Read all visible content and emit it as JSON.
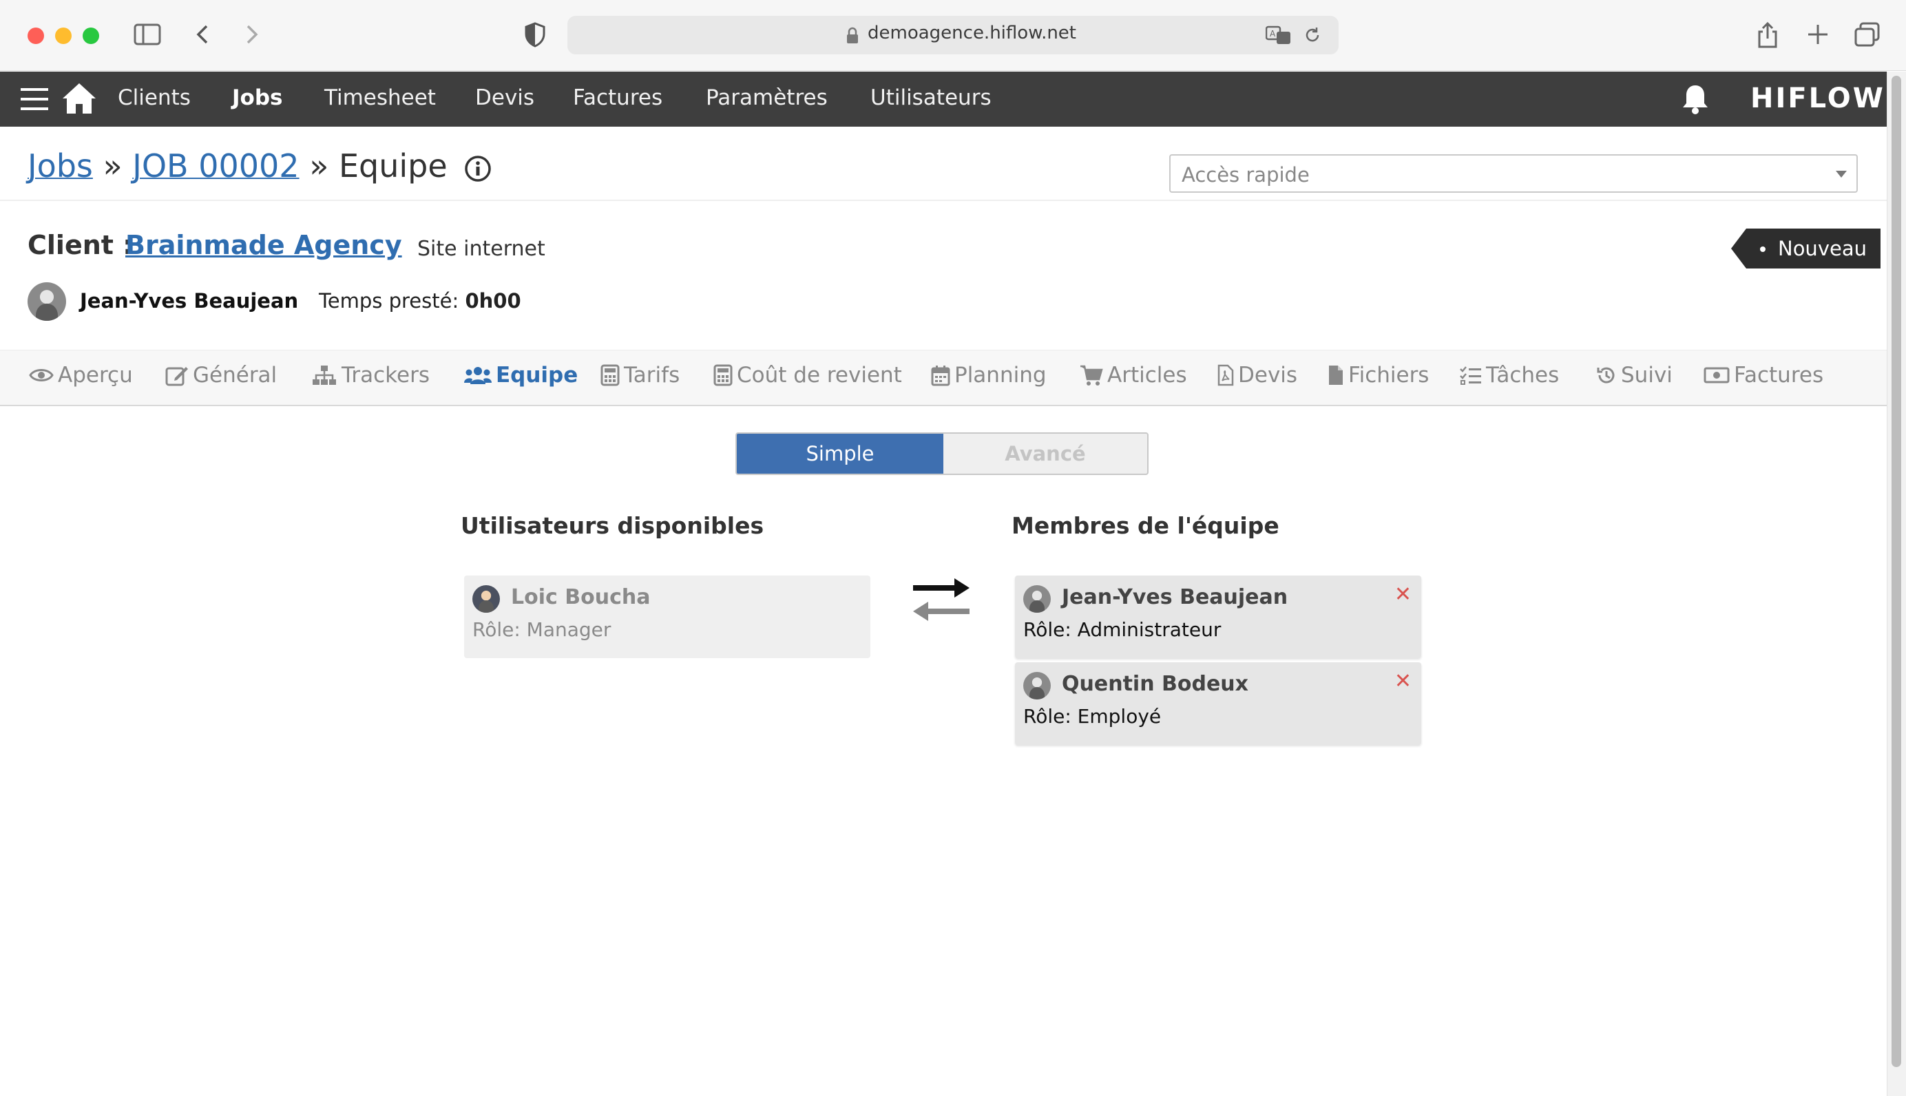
{
  "browser": {
    "url": "demoagence.hiflow.net"
  },
  "nav": {
    "items": [
      "Clients",
      "Jobs",
      "Timesheet",
      "Devis",
      "Factures",
      "Paramètres",
      "Utilisateurs"
    ],
    "active": "Jobs",
    "logo": "HIFLOW"
  },
  "breadcrumb": {
    "root": "Jobs",
    "sep": "»",
    "job": "JOB 00002",
    "current": "Equipe"
  },
  "quick_access": {
    "placeholder": "Accès rapide"
  },
  "client": {
    "label": "Client :",
    "name": "Brainmade Agency",
    "project": "Site internet"
  },
  "status_badge": "Nouveau",
  "owner": {
    "name": "Jean-Yves Beaujean",
    "time_label": "Temps presté:",
    "time_value": "0h00"
  },
  "tabs": [
    {
      "label": "Aperçu",
      "icon": "eye-icon"
    },
    {
      "label": "Général",
      "icon": "edit-icon"
    },
    {
      "label": "Trackers",
      "icon": "sitemap-icon"
    },
    {
      "label": "Equipe",
      "icon": "users-icon",
      "active": true
    },
    {
      "label": "Tarifs",
      "icon": "calculator-icon"
    },
    {
      "label": "Coût de revient",
      "icon": "calculator-icon"
    },
    {
      "label": "Planning",
      "icon": "calendar-icon"
    },
    {
      "label": "Articles",
      "icon": "cart-icon"
    },
    {
      "label": "Devis",
      "icon": "pdf-file-icon"
    },
    {
      "label": "Fichiers",
      "icon": "file-icon"
    },
    {
      "label": "Tâches",
      "icon": "tasks-icon"
    },
    {
      "label": "Suivi",
      "icon": "history-icon"
    },
    {
      "label": "Factures",
      "icon": "money-icon"
    }
  ],
  "mode_toggle": {
    "simple": "Simple",
    "advanced": "Avancé",
    "selected": "Simple"
  },
  "available": {
    "title": "Utilisateurs disponibles",
    "users": [
      {
        "name": "Loic Boucha",
        "role": "Rôle: Manager"
      }
    ]
  },
  "team": {
    "title": "Membres de l'équipe",
    "members": [
      {
        "name": "Jean-Yves Beaujean",
        "role": "Rôle: Administrateur"
      },
      {
        "name": "Quentin Bodeux",
        "role": "Rôle: Employé"
      }
    ]
  },
  "remove_glyph": "✕",
  "colors": {
    "navbar": "#3e3e3e",
    "link": "#2f6db0",
    "toggle_active": "#3e6fb0",
    "remove": "#d9534f"
  }
}
